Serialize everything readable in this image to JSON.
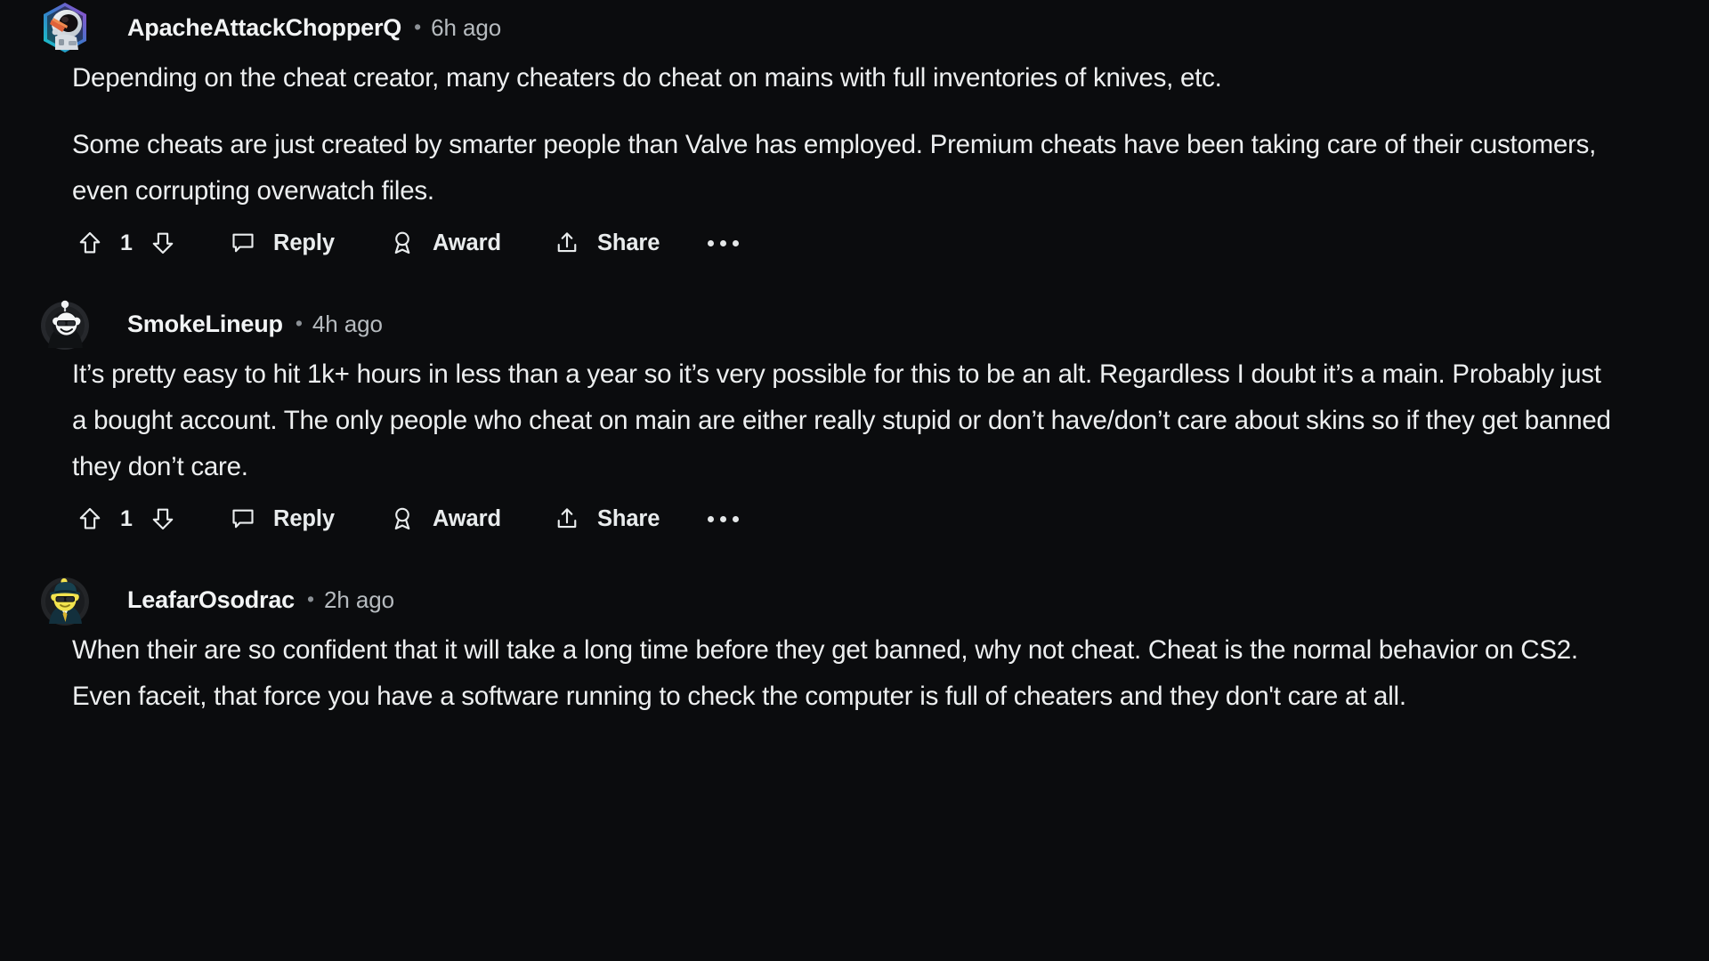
{
  "theme": {
    "background": "#0b0c0e",
    "text_primary": "#edeff0",
    "text_muted": "#b6bbbf"
  },
  "comments": [
    {
      "username": "ApacheAttackChopperQ",
      "separator": "•",
      "timestamp": "6h ago",
      "avatar": "astronaut-helmet-hex-avatar",
      "paragraphs": [
        "Depending on the cheat creator, many cheaters do cheat on mains with full inventories of knives, etc.",
        "Some cheats are just created by smarter people than Valve has employed. Premium cheats have been taking care of their customers, even corrupting overwatch files."
      ],
      "actions": {
        "upvote_icon": "upvote-arrow-icon",
        "vote_count": "1",
        "downvote_icon": "downvote-arrow-icon",
        "reply_icon": "comment-bubble-icon",
        "reply_label": "Reply",
        "award_icon": "award-ribbon-icon",
        "award_label": "Award",
        "share_icon": "share-arrow-icon",
        "share_label": "Share",
        "more_icon": "overflow-dots-icon"
      }
    },
    {
      "username": "SmokeLineup",
      "separator": "•",
      "timestamp": "4h ago",
      "avatar": "snoo-hoodie-sunglasses-avatar",
      "paragraphs": [
        "It’s pretty easy to hit 1k+ hours in less than a year so it’s very possible for this to be an alt. Regardless I doubt it’s a main. Probably just a bought account. The only people who cheat on main are either really stupid or don’t have/don’t care about skins so if they get banned they don’t care."
      ],
      "actions": {
        "upvote_icon": "upvote-arrow-icon",
        "vote_count": "1",
        "downvote_icon": "downvote-arrow-icon",
        "reply_icon": "comment-bubble-icon",
        "reply_label": "Reply",
        "award_icon": "award-ribbon-icon",
        "award_label": "Award",
        "share_icon": "share-arrow-icon",
        "share_label": "Share",
        "more_icon": "overflow-dots-icon"
      }
    },
    {
      "username": "LeafarOsodrac",
      "separator": "•",
      "timestamp": "2h ago",
      "avatar": "snoo-yellow-hat-suit-avatar",
      "paragraphs": [
        "When their are so confident that it will take a long time before they get banned, why not cheat. Cheat is the normal behavior on CS2. Even faceit, that force you have a software running to check the computer is full of cheaters and they don't care at all."
      ]
    }
  ]
}
